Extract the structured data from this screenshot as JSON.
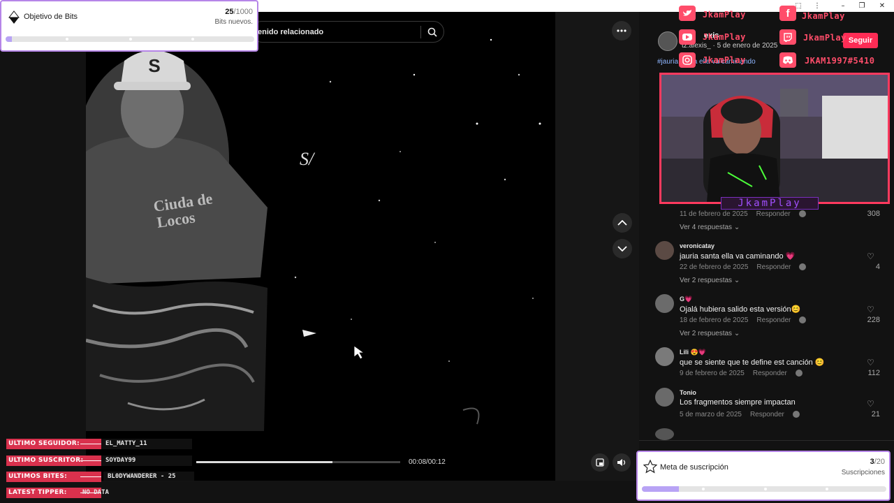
{
  "colors": {
    "accent": "#fe2c55",
    "overlay_pink": "#ff4d6a",
    "goal_purple": "#b685e8",
    "goal_fill": "#b8a3f5"
  },
  "bits_goal": {
    "title": "Objetivo de Bits",
    "current": "25",
    "total": "/1000",
    "subtitle": "Bits nuevos.",
    "progress": 0.025,
    "icon": "diamond-icon"
  },
  "search": {
    "placeholder_visible": "enido relacionado",
    "icon": "search-icon"
  },
  "video": {
    "watermark": "S/",
    "time": "00:08/00:12",
    "progress": 0.667
  },
  "author": {
    "name_partial": "exis",
    "meta": "tz.alexis_ · 5 de enero de 2025",
    "hashtag": "#jauria santa ella va caminando",
    "follow_label": "Seguir"
  },
  "social": {
    "twitter": "JkamPlay",
    "facebook": "JkamPlay",
    "youtube": "JkamPlay",
    "twitch": "JkamPlay",
    "instagram": "JkamPlay",
    "discord": "JKAM1997#5410"
  },
  "webcam": {
    "name": "JkamPlay"
  },
  "comments": [
    {
      "name": "",
      "text": "",
      "date": "11 de febrero de 2025",
      "reply": "Responder",
      "likes": "308",
      "more": "Ver 4 respuestas"
    },
    {
      "name": "veronicatay",
      "text": "jauria santa ella va caminando 💗",
      "date": "22 de febrero de 2025",
      "reply": "Responder",
      "likes": "4",
      "more": "Ver 2 respuestas"
    },
    {
      "name": "G💗",
      "text": "Ojalá hubiera salido esta versión😊",
      "date": "18 de febrero de 2025",
      "reply": "Responder",
      "likes": "228",
      "more": "Ver 2 respuestas"
    },
    {
      "name": "Lili 😍💗",
      "text": "que se siente que te define est canción 😊",
      "date": "9 de febrero de 2025",
      "reply": "Responder",
      "likes": "112",
      "more": ""
    },
    {
      "name": "Tonio",
      "text": "Los fragmentos siempre impactan",
      "date": "5 de marzo de 2025",
      "reply": "Responder",
      "likes": "21",
      "more": ""
    }
  ],
  "subs_goal": {
    "title": "Meta de suscripción",
    "current": "3",
    "total": "/20",
    "subtitle": "Suscripciones",
    "progress": 0.15,
    "icon": "star-icon"
  },
  "stream_labels": [
    {
      "label": "ULTIMO SEGUIDOR:",
      "value": "EL_MATTY_11"
    },
    {
      "label": "ULTIMO SUSCRITOR:",
      "value": "SOYDAY99"
    },
    {
      "label": "ULTIMOS BITES:",
      "value": "BL0DYWANDERER - 25"
    },
    {
      "label": "LATEST TIPPER:",
      "value": "NO DATA"
    }
  ]
}
